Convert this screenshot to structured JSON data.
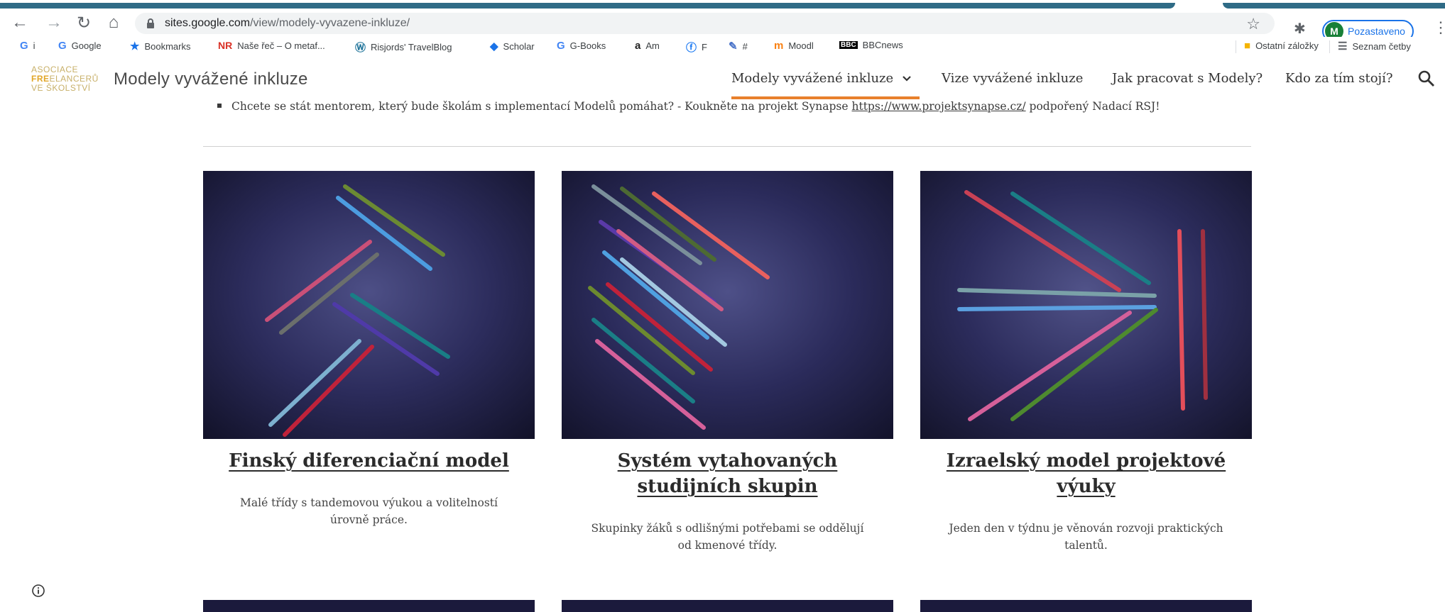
{
  "browser": {
    "url_domain": "sites.google.com",
    "url_path": "/view/modely-vyvazene-inkluze/",
    "profile_initial": "M",
    "profile_status": "Pozastaveno"
  },
  "bookmarks": {
    "items": [
      {
        "icon": "G",
        "label": "i"
      },
      {
        "icon": "G",
        "label": "Google"
      },
      {
        "icon": "★",
        "label": "Bookmarks"
      },
      {
        "icon": "NR",
        "label": "Naše řeč – O metaf..."
      },
      {
        "icon": "W",
        "label": "Risjords' TravelBlog"
      },
      {
        "icon": "🎓",
        "label": "Scholar"
      },
      {
        "icon": "G",
        "label": "G-Books"
      },
      {
        "icon": "a",
        "label": "Am"
      },
      {
        "icon": "f",
        "label": "F"
      },
      {
        "icon": "✎",
        "label": "#"
      },
      {
        "icon": "m",
        "label": "Moodl"
      },
      {
        "icon": "BBC",
        "label": "BBCnews"
      }
    ],
    "other": "Ostatní záložky",
    "reading_list": "Seznam četby"
  },
  "site": {
    "logo": {
      "line1": "ASOCIACE",
      "line2_a": "FRE",
      "line2_b": "ELANCERŮ",
      "line3": "VE ŠKOLSTVÍ"
    },
    "title": "Modely vyvážené inkluze",
    "nav": [
      {
        "label": "Modely vyvážené inkluze",
        "active": true
      },
      {
        "label": "Vize vyvážené inkluze"
      },
      {
        "label": "Jak pracovat s Modely?"
      },
      {
        "label": "Kdo za tím stojí?"
      }
    ]
  },
  "content": {
    "bullet_text_before": "Chcete se stát mentorem, který bude školám s implementací Modelů pomáhat? - Koukněte na projekt Synapse ",
    "bullet_link": "https://www.projektsynapse.cz/",
    "bullet_text_after": " podpořený Nadací RSJ!",
    "cards": [
      {
        "title_l1": "Finský diferenciační model",
        "title_l2": "",
        "desc_l1": "Malé třídy s tandemovou výukou a volitelností",
        "desc_l2": "úrovně práce."
      },
      {
        "title_l1": "Systém vytahovaných",
        "title_l2": "studijních skupin",
        "desc_l1": "Skupinky žáků s odlišnými potřebami se oddělují",
        "desc_l2": "od kmenové třídy."
      },
      {
        "title_l1": "Izraelský model projektové",
        "title_l2": "výuky",
        "desc_l1": "Jeden den v týdnu je věnován rozvoji praktických",
        "desc_l2": "talentů."
      }
    ]
  },
  "colors": {
    "accent": "#e8802c",
    "chrome_stripe": "#2f6b86"
  }
}
